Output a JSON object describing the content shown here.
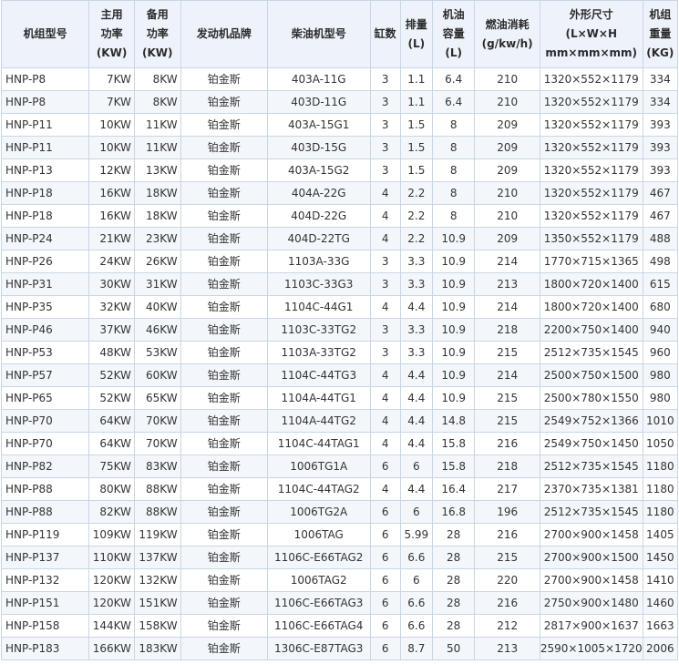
{
  "headers": [
    [
      "机组型号"
    ],
    [
      "主用",
      "功率",
      "(KW)"
    ],
    [
      "备用",
      "功率",
      "(KW)"
    ],
    [
      "发动机品牌"
    ],
    [
      "柴油机型号"
    ],
    [
      "缸数"
    ],
    [
      "排量",
      "(L)"
    ],
    [
      "机油",
      "容量",
      "(L)"
    ],
    [
      "燃油消耗",
      "(g/kw/h)"
    ],
    [
      "外形尺寸",
      "(L×W×H",
      "mm×mm×mm)"
    ],
    [
      "机组",
      "重量",
      "(KG)"
    ]
  ],
  "rows": [
    [
      "HNP-P8",
      "7KW",
      "8KW",
      "铂金斯",
      "403A-11G",
      "3",
      "1.1",
      "6.4",
      "210",
      "1320×552×1179",
      "334"
    ],
    [
      "HNP-P8",
      "7KW",
      "8KW",
      "铂金斯",
      "403D-11G",
      "3",
      "1.1",
      "6.4",
      "210",
      "1320×552×1179",
      "334"
    ],
    [
      "HNP-P11",
      "10KW",
      "11KW",
      "铂金斯",
      "403A-15G1",
      "3",
      "1.5",
      "8",
      "209",
      "1320×552×1179",
      "393"
    ],
    [
      "HNP-P11",
      "10KW",
      "11KW",
      "铂金斯",
      "403D-15G",
      "3",
      "1.5",
      "8",
      "209",
      "1320×552×1179",
      "393"
    ],
    [
      "HNP-P13",
      "12KW",
      "13KW",
      "铂金斯",
      "403A-15G2",
      "3",
      "1.5",
      "8",
      "209",
      "1320×552×1179",
      "393"
    ],
    [
      "HNP-P18",
      "16KW",
      "18KW",
      "铂金斯",
      "404A-22G",
      "4",
      "2.2",
      "8",
      "210",
      "1320×552×1179",
      "467"
    ],
    [
      "HNP-P18",
      "16KW",
      "18KW",
      "铂金斯",
      "404D-22G",
      "4",
      "2.2",
      "8",
      "210",
      "1320×552×1179",
      "467"
    ],
    [
      "HNP-P24",
      "21KW",
      "23KW",
      "铂金斯",
      "404D-22TG",
      "4",
      "2.2",
      "10.9",
      "209",
      "1350×552×1179",
      "488"
    ],
    [
      "HNP-P26",
      "24KW",
      "26KW",
      "铂金斯",
      "1103A-33G",
      "3",
      "3.3",
      "10.9",
      "214",
      "1770×715×1365",
      "498"
    ],
    [
      "HNP-P31",
      "30KW",
      "31KW",
      "铂金斯",
      "1103C-33G3",
      "3",
      "3.3",
      "10.9",
      "213",
      "1800×720×1400",
      "615"
    ],
    [
      "HNP-P35",
      "32KW",
      "40KW",
      "铂金斯",
      "1104C-44G1",
      "4",
      "4.4",
      "10.9",
      "214",
      "1800×720×1400",
      "680"
    ],
    [
      "HNP-P46",
      "37KW",
      "46KW",
      "铂金斯",
      "1103C-33TG2",
      "3",
      "3.3",
      "10.9",
      "218",
      "2200×750×1400",
      "940"
    ],
    [
      "HNP-P53",
      "48KW",
      "53KW",
      "铂金斯",
      "1103A-33TG2",
      "3",
      "3.3",
      "10.9",
      "215",
      "2512×735×1545",
      "960"
    ],
    [
      "HNP-P57",
      "52KW",
      "60KW",
      "铂金斯",
      "1104C-44TG3",
      "4",
      "4.4",
      "10.9",
      "214",
      "2500×750×1500",
      "980"
    ],
    [
      "HNP-P65",
      "52KW",
      "65KW",
      "铂金斯",
      "1104A-44TG1",
      "4",
      "4.4",
      "10.9",
      "215",
      "2500×780×1550",
      "980"
    ],
    [
      "HNP-P70",
      "64KW",
      "70KW",
      "铂金斯",
      "1104A-44TG2",
      "4",
      "4.4",
      "14.8",
      "215",
      "2549×752×1366",
      "1010"
    ],
    [
      "HNP-P70",
      "64KW",
      "70KW",
      "铂金斯",
      "1104C-44TAG1",
      "4",
      "4.4",
      "15.8",
      "216",
      "2549×750×1450",
      "1050"
    ],
    [
      "HNP-P82",
      "75KW",
      "83KW",
      "铂金斯",
      "1006TG1A",
      "6",
      "6",
      "15.8",
      "218",
      "2512×735×1545",
      "1180"
    ],
    [
      "HNP-P88",
      "80KW",
      "88KW",
      "铂金斯",
      "1104C-44TAG2",
      "4",
      "4.4",
      "16.4",
      "217",
      "2370×735×1381",
      "1180"
    ],
    [
      "HNP-P88",
      "82KW",
      "88KW",
      "铂金斯",
      "1006TG2A",
      "6",
      "6",
      "16.8",
      "196",
      "2512×735×1545",
      "1180"
    ],
    [
      "HNP-P119",
      "109KW",
      "119KW",
      "铂金斯",
      "1006TAG",
      "6",
      "5.99",
      "28",
      "216",
      "2700×900×1458",
      "1405"
    ],
    [
      "HNP-P137",
      "110KW",
      "137KW",
      "铂金斯",
      "1106C-E66TAG2",
      "6",
      "6.6",
      "28",
      "215",
      "2700×900×1500",
      "1450"
    ],
    [
      "HNP-P132",
      "120KW",
      "132KW",
      "铂金斯",
      "1006TAG2",
      "6",
      "6",
      "28",
      "220",
      "2700×900×1458",
      "1410"
    ],
    [
      "HNP-P151",
      "120KW",
      "151KW",
      "铂金斯",
      "1106C-E66TAG3",
      "6",
      "6.6",
      "28",
      "216",
      "2750×900×1480",
      "1460"
    ],
    [
      "HNP-P158",
      "144KW",
      "158KW",
      "铂金斯",
      "1106C-E66TAG4",
      "6",
      "6.6",
      "28",
      "212",
      "2817×900×1637",
      "1663"
    ],
    [
      "HNP-P183",
      "166KW",
      "183KW",
      "铂金斯",
      "1306C-E87TAG3",
      "6",
      "8.7",
      "50",
      "213",
      "2590×1005×1720",
      "2006"
    ]
  ]
}
